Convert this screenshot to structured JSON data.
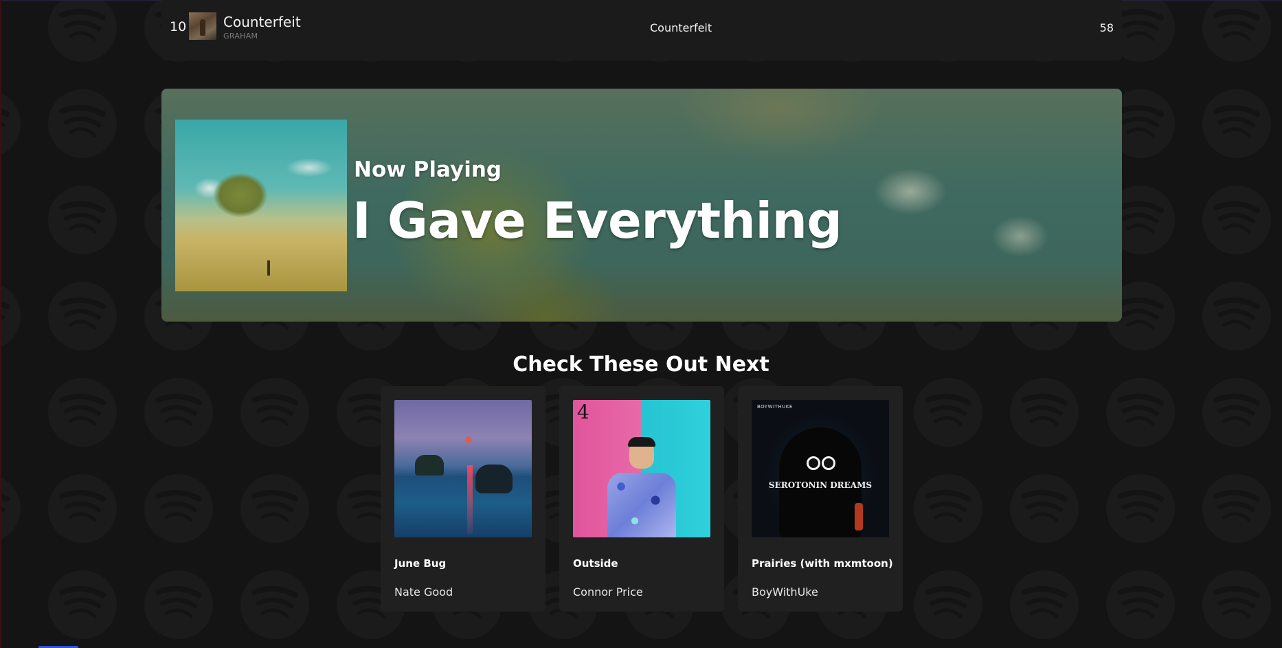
{
  "top_track": {
    "rank": "10",
    "title": "Counterfeit",
    "artist": "GRAHAM",
    "album": "Counterfeit",
    "plays": "58"
  },
  "now_playing": {
    "label": "Now Playing",
    "title": "I Gave Everything"
  },
  "recommendations": {
    "heading": "Check These Out Next",
    "items": [
      {
        "title": "June Bug",
        "artist": "Nate Good"
      },
      {
        "title": "Outside",
        "artist": "Connor Price",
        "art_text": "4"
      },
      {
        "title": "Prairies (with mxmtoon)",
        "artist": "BoyWithUke",
        "art_brand": "BOYWITHUKE",
        "art_text": "SEROTONIN DREAMS"
      }
    ]
  },
  "colors": {
    "page_background": "#141414",
    "row_background": "#1b1b1b",
    "card_background": "#202020",
    "muted_text": "#7c7c7c",
    "watermark_icon": "spotify-logo"
  }
}
